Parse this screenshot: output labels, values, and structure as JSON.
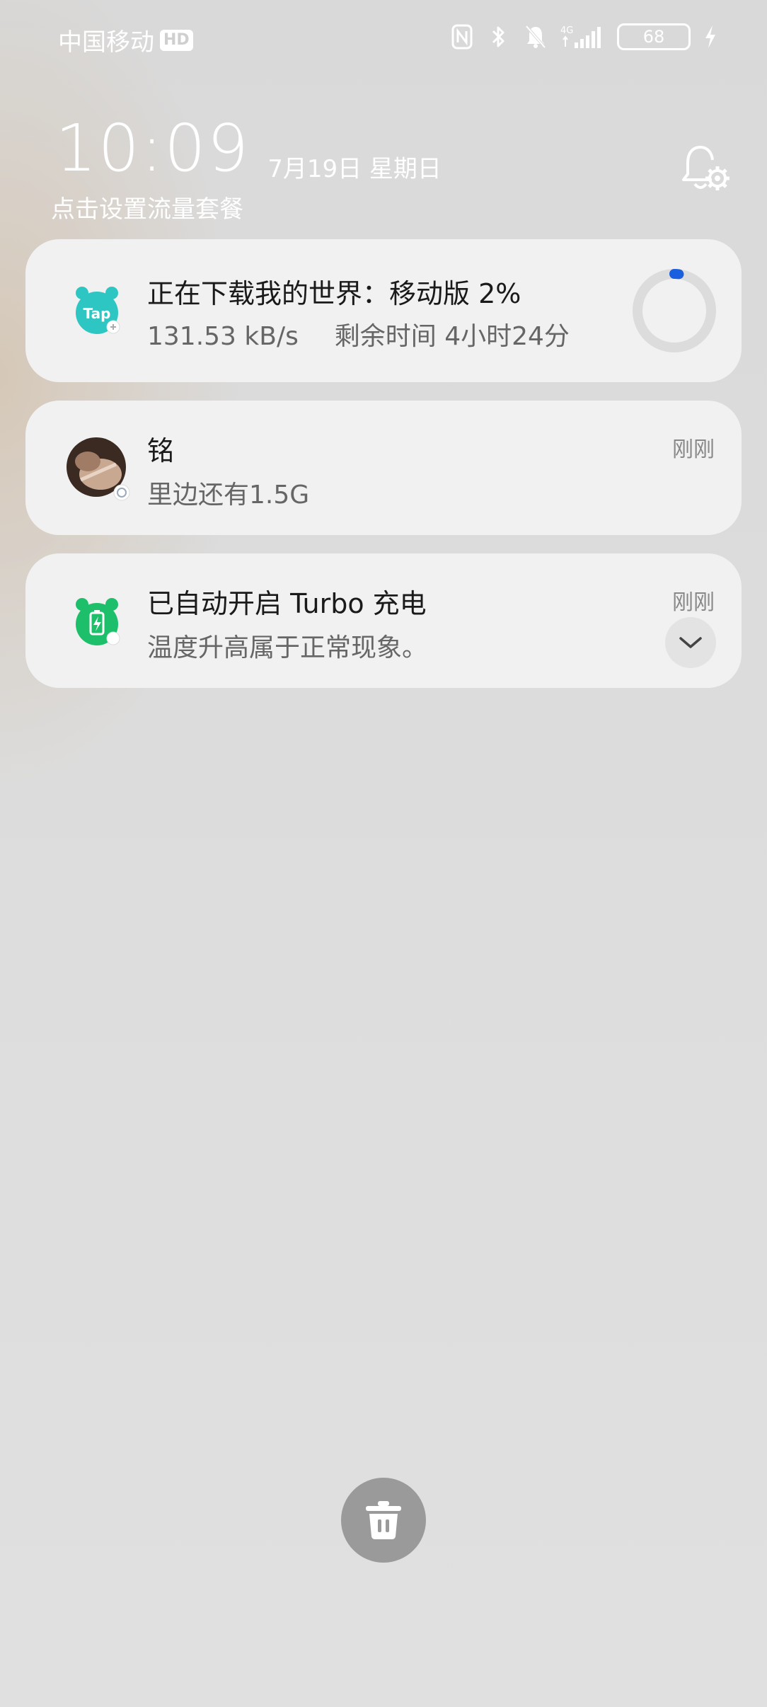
{
  "status_bar": {
    "carrier": "中国移动",
    "hd_badge": "HD",
    "network": "4G",
    "battery_level": "68",
    "icons": [
      "nfc-icon",
      "bluetooth-icon",
      "bell-off-icon",
      "signal-icon",
      "battery-icon",
      "charging-icon"
    ]
  },
  "lockscreen": {
    "time": "10:09",
    "date": "7月19日 星期日",
    "data_plan_link": "点击设置流量套餐"
  },
  "notifications": [
    {
      "app_icon": "taptap-icon",
      "title": "正在下载我的世界：移动版 2%",
      "speed": "131.53 kB/s",
      "remaining": "剩余时间 4小时24分",
      "progress_percent": 2
    },
    {
      "app_icon": "avatar",
      "title": "铭",
      "body": "里边还有1.5G",
      "time": "刚刚"
    },
    {
      "app_icon": "battery-charge-icon",
      "title": "已自动开启 Turbo 充电",
      "body": "温度升高属于正常现象。",
      "time": "刚刚"
    }
  ],
  "colors": {
    "accent": "#1a5fe0",
    "tap_teal": "#2ec6c3",
    "charge_green": "#1dbf6a",
    "card_bg": "#f1f1f1",
    "clear_button": "#9a9a9a"
  }
}
